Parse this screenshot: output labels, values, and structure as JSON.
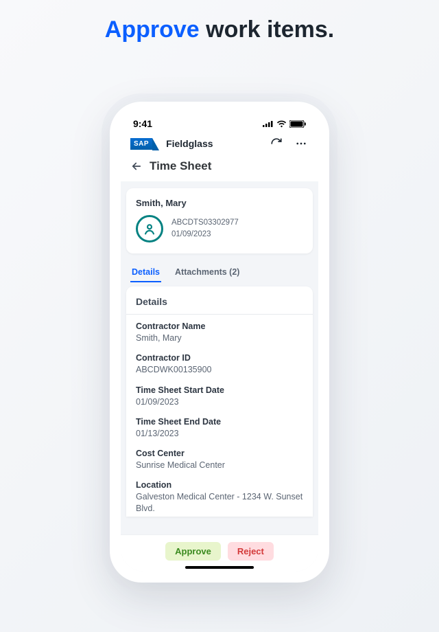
{
  "hero": {
    "accent": "Approve",
    "rest": " work items."
  },
  "status": {
    "time": "9:41"
  },
  "header": {
    "brand_badge": "SAP",
    "brand_name": "Fieldglass"
  },
  "subheader": {
    "title": "Time Sheet"
  },
  "summary": {
    "name": "Smith, Mary",
    "ref": "ABCDTS03302977",
    "date": "01/09/2023"
  },
  "tabs": {
    "details": "Details",
    "attachments": "Attachments (2)"
  },
  "details": {
    "title": "Details",
    "fields": {
      "contractor_name": {
        "label": "Contractor Name",
        "value": "Smith, Mary"
      },
      "contractor_id": {
        "label": "Contractor ID",
        "value": "ABCDWK00135900"
      },
      "start_date": {
        "label": "Time Sheet Start Date",
        "value": "01/09/2023"
      },
      "end_date": {
        "label": "Time Sheet End Date",
        "value": "01/13/2023"
      },
      "cost_center": {
        "label": "Cost Center",
        "value": "Sunrise Medical Center"
      },
      "location": {
        "label": "Location",
        "value": "Galveston Medical Center - 1234 W. Sunset Blvd."
      }
    }
  },
  "footer": {
    "approve": "Approve",
    "reject": "Reject"
  }
}
